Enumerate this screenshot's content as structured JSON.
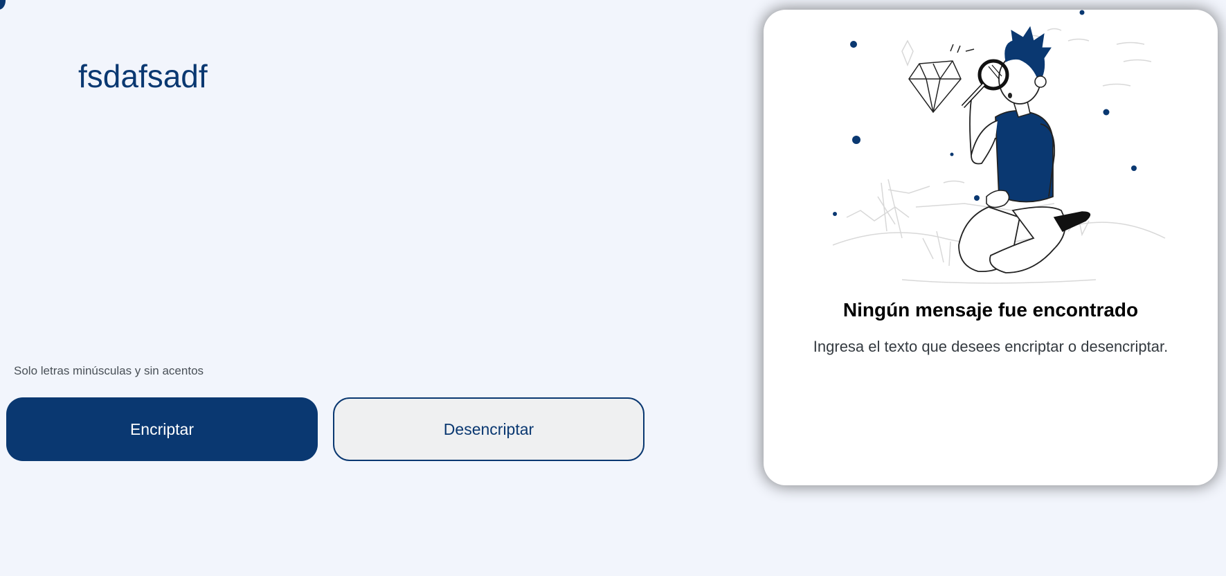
{
  "colors": {
    "accent": "#0a3871",
    "background": "#f2f5fc",
    "card": "#ffffff"
  },
  "input": {
    "value": "fsdafsadf"
  },
  "hint": {
    "icon": "info-icon",
    "text": "Solo letras minúsculas y sin acentos"
  },
  "buttons": {
    "encrypt_label": "Encriptar",
    "decrypt_label": "Desencriptar"
  },
  "output": {
    "illustration": "person-with-magnifying-glass",
    "title": "Ningún mensaje fue encontrado",
    "subtitle": "Ingresa el texto que desees encriptar o desencriptar."
  }
}
